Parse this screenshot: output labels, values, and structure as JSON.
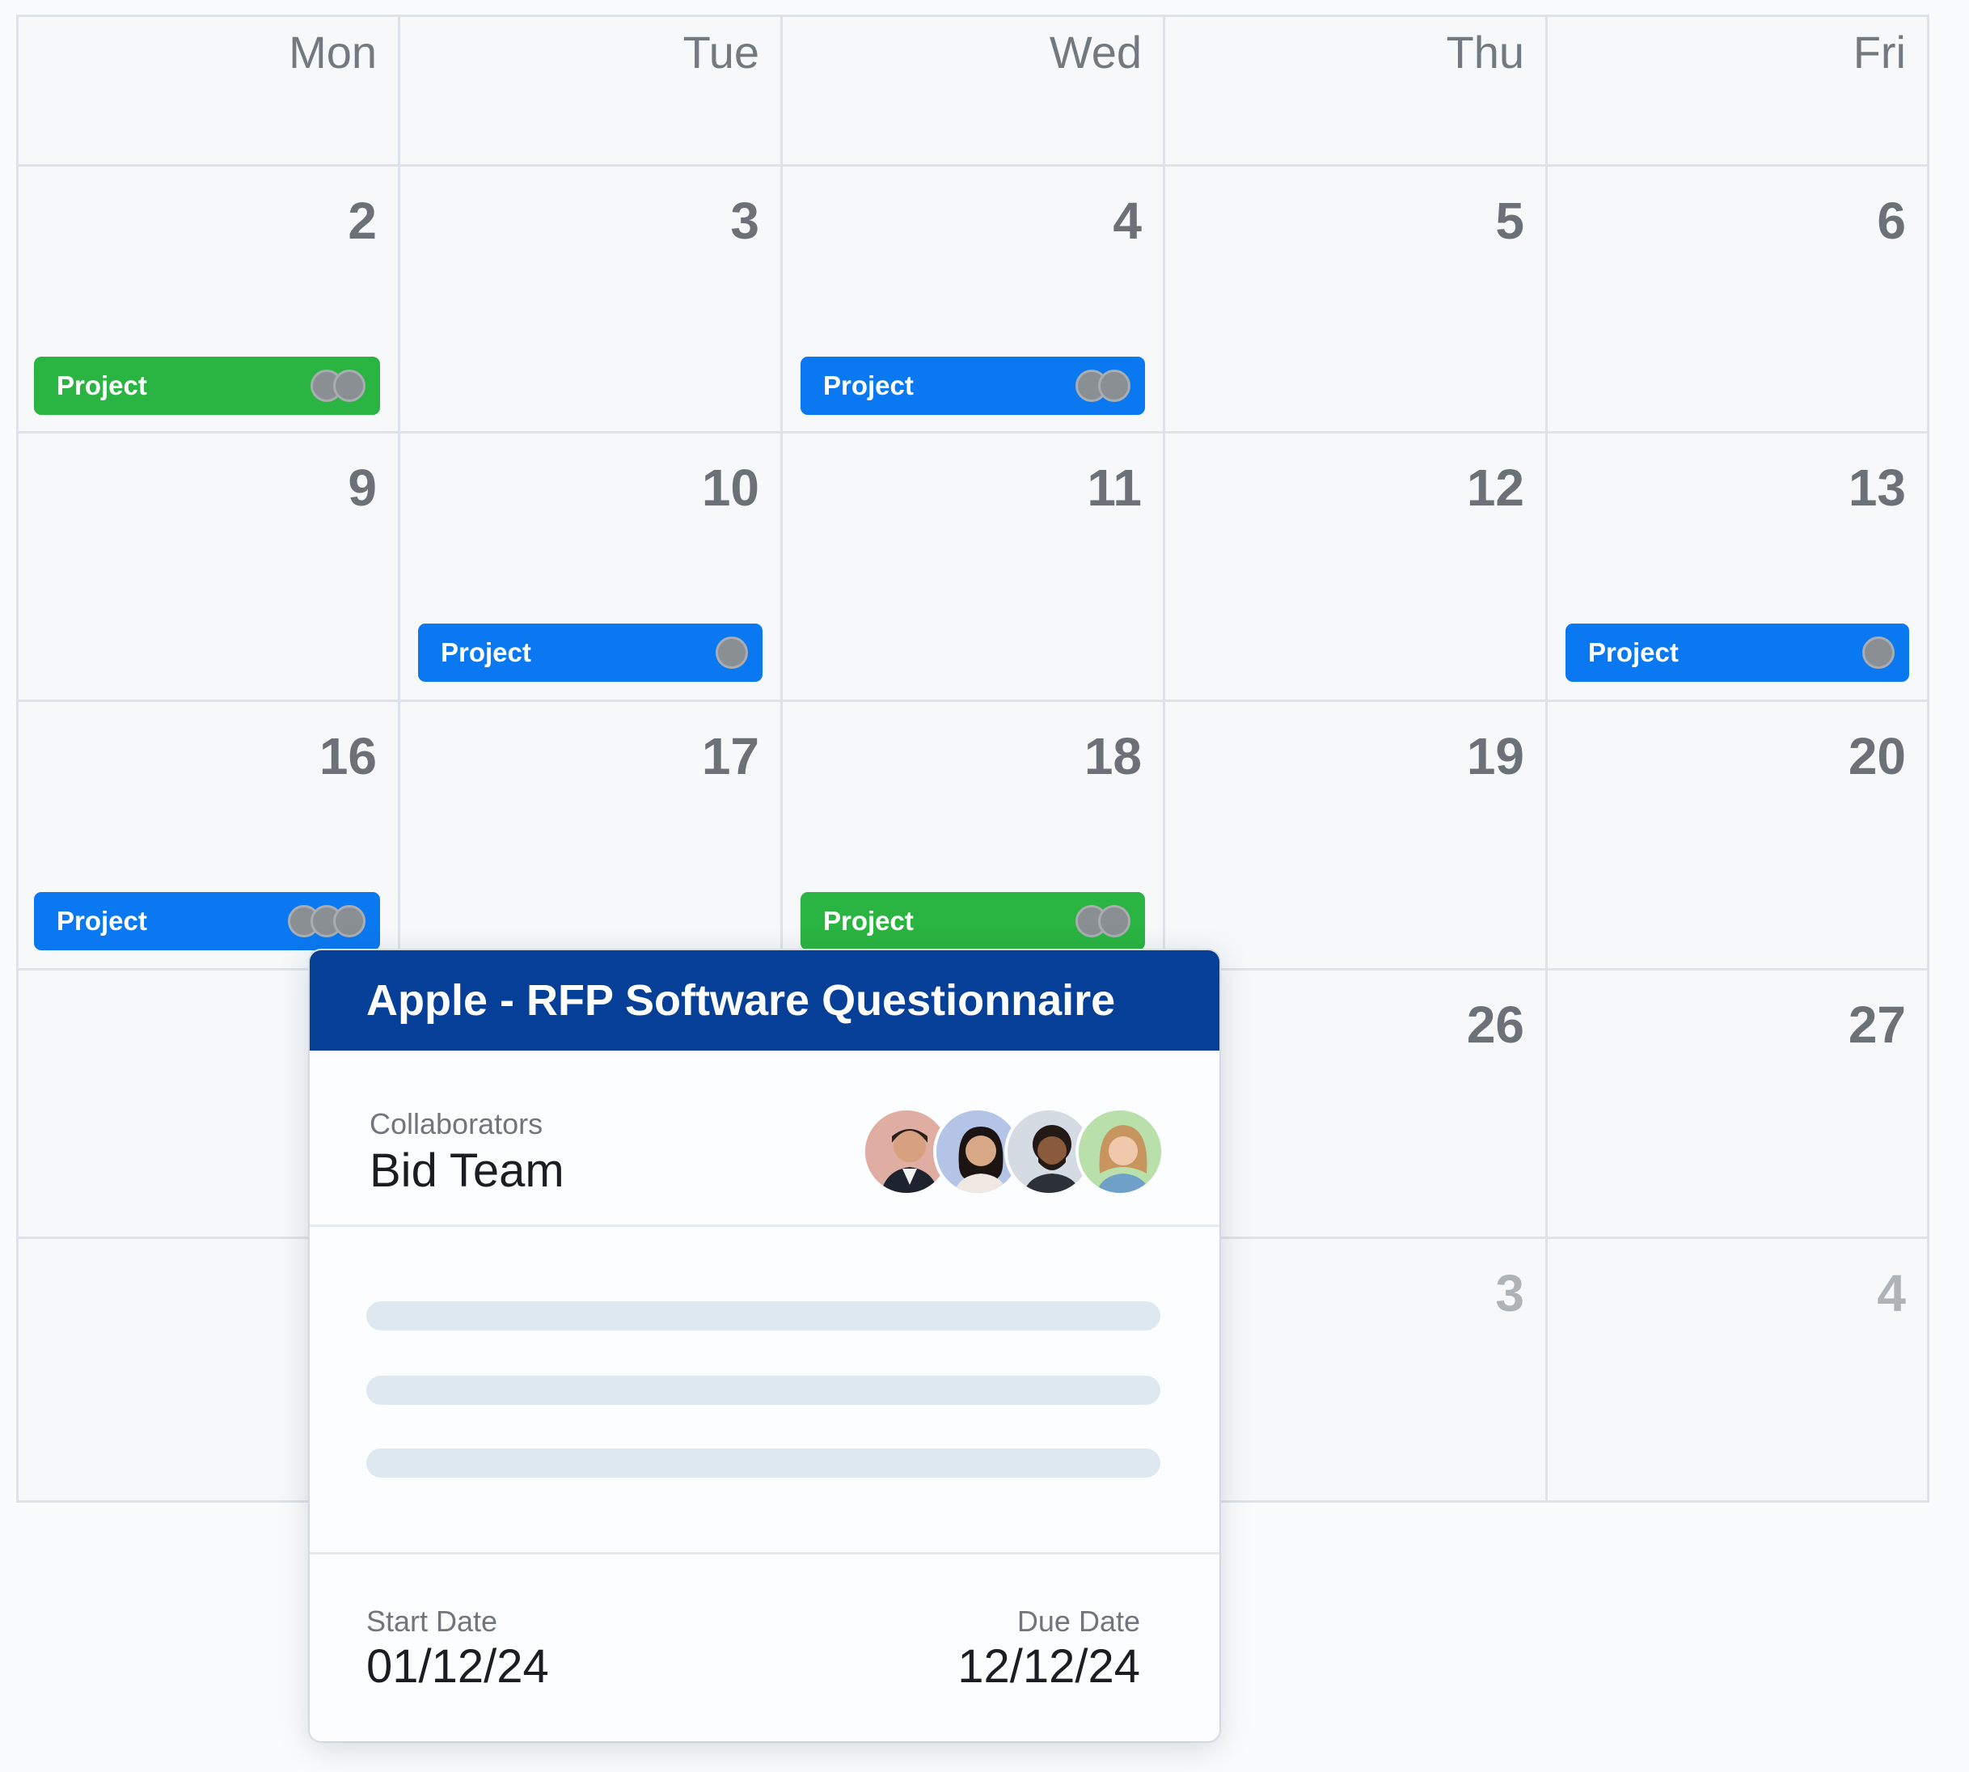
{
  "calendar": {
    "weekdays": [
      "Mon",
      "Tue",
      "Wed",
      "Thu",
      "Fri"
    ],
    "weeks": [
      {
        "days": [
          "2",
          "3",
          "4",
          "5",
          "6"
        ]
      },
      {
        "days": [
          "9",
          "10",
          "11",
          "12",
          "13"
        ]
      },
      {
        "days": [
          "16",
          "17",
          "18",
          "19",
          "20"
        ]
      },
      {
        "days": [
          "",
          "",
          "",
          "26",
          "27"
        ]
      },
      {
        "days": [
          "",
          "",
          "",
          "3",
          "4"
        ]
      }
    ],
    "events": [
      {
        "label": "Project",
        "week": 0,
        "day": 0,
        "color": "#2ab441",
        "collaborators": 2
      },
      {
        "label": "Project",
        "week": 0,
        "day": 2,
        "color": "#0a78f0",
        "collaborators": 2
      },
      {
        "label": "Project",
        "week": 1,
        "day": 1,
        "color": "#0a78f0",
        "collaborators": 1
      },
      {
        "label": "Project",
        "week": 1,
        "day": 4,
        "color": "#0a78f0",
        "collaborators": 1
      },
      {
        "label": "Project",
        "week": 2,
        "day": 0,
        "color": "#0a78f0",
        "collaborators": 3
      },
      {
        "label": "Project",
        "week": 2,
        "day": 2,
        "color": "#2ab441",
        "collaborators": 2
      }
    ]
  },
  "popup": {
    "title": "Apple - RFP Software Questionnaire",
    "collaborators_label": "Collaborators",
    "collaborators_value": "Bid Team",
    "start_date_label": "Start Date",
    "start_date": "01/12/24",
    "due_date_label": "Due Date",
    "due_date": "12/12/24",
    "header_color": "#053f98"
  }
}
